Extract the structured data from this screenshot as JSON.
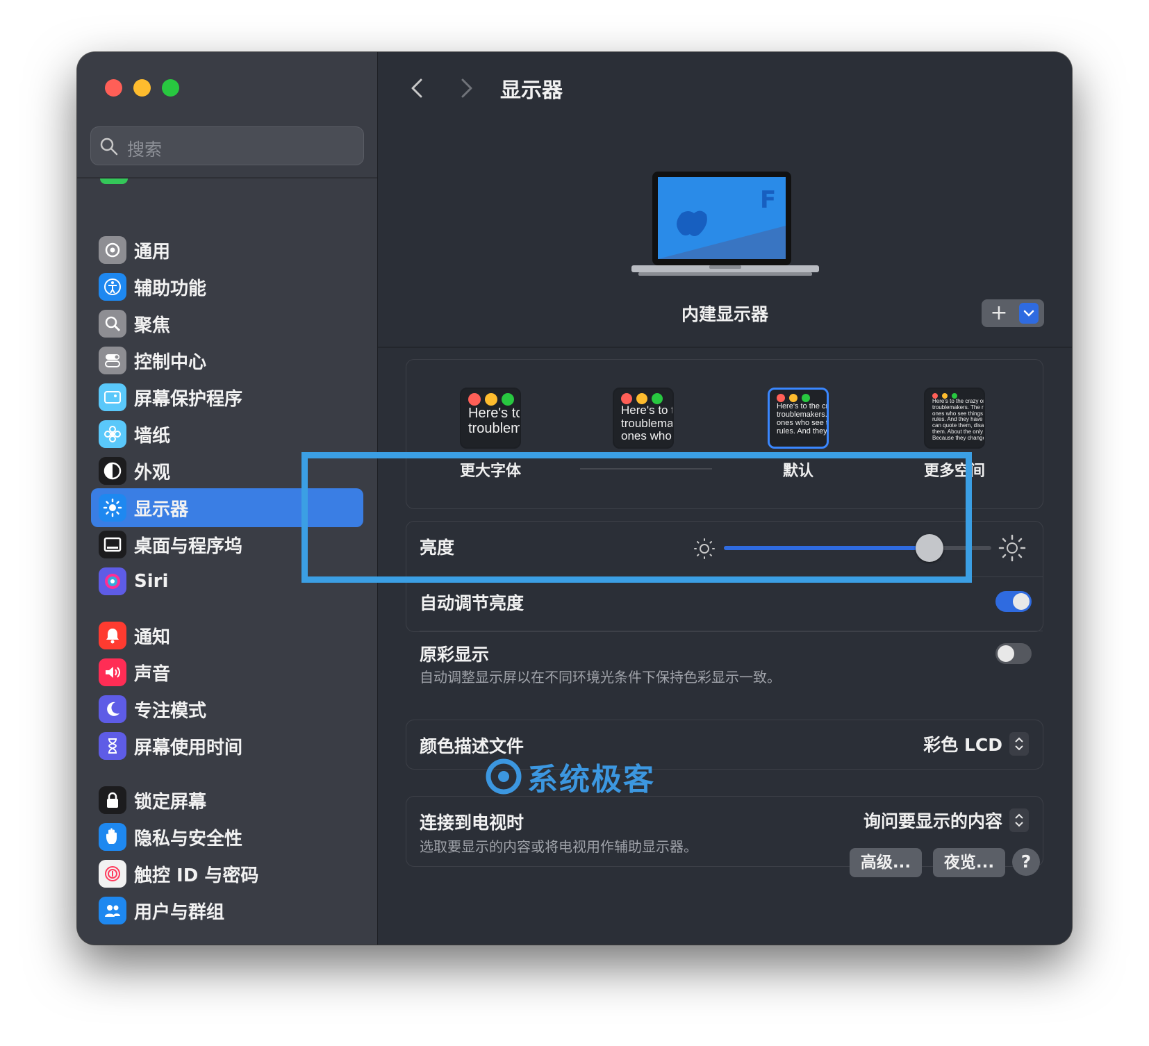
{
  "sidebar": {
    "search_placeholder": "搜索",
    "items": [
      {
        "label": "通用",
        "icon": "gear-icon",
        "color": "#8e8e93"
      },
      {
        "label": "辅助功能",
        "icon": "accessibility-icon",
        "color": "#1e88f0"
      },
      {
        "label": "聚焦",
        "icon": "magnifier-icon",
        "color": "#8e8e93"
      },
      {
        "label": "控制中心",
        "icon": "toggles-icon",
        "color": "#8e8e93"
      },
      {
        "label": "屏幕保护程序",
        "icon": "screensaver-icon",
        "color": "#5ac8fa"
      },
      {
        "label": "墙纸",
        "icon": "flower-icon",
        "color": "#5ac8fa"
      },
      {
        "label": "外观",
        "icon": "appearance-icon",
        "color": "#1c1c1e"
      },
      {
        "label": "显示器",
        "icon": "sun-icon",
        "color": "#1e88f0",
        "active": true
      },
      {
        "label": "桌面与程序坞",
        "icon": "dock-icon",
        "color": "#1c1c1e"
      },
      {
        "label": "Siri",
        "icon": "siri-icon",
        "color": "#5e5ce6"
      },
      {
        "label": "通知",
        "icon": "bell-icon",
        "color": "#ff3b30"
      },
      {
        "label": "声音",
        "icon": "speaker-icon",
        "color": "#ff2d55"
      },
      {
        "label": "专注模式",
        "icon": "moon-icon",
        "color": "#5e5ce6"
      },
      {
        "label": "屏幕使用时间",
        "icon": "hourglass-icon",
        "color": "#5e5ce6"
      },
      {
        "label": "锁定屏幕",
        "icon": "lock-icon",
        "color": "#1c1c1e"
      },
      {
        "label": "隐私与安全性",
        "icon": "hand-icon",
        "color": "#1e88f0"
      },
      {
        "label": "触控 ID 与密码",
        "icon": "fingerprint-icon",
        "color": "#f2f2f2"
      },
      {
        "label": "用户与群组",
        "icon": "users-icon",
        "color": "#1e88f0"
      }
    ]
  },
  "header": {
    "title": "显示器"
  },
  "display": {
    "name": "内建显示器",
    "add_label": "+"
  },
  "resolution": {
    "options": [
      {
        "label": "更大字体",
        "preview": "Here's tc\ntroublem"
      },
      {
        "label": "",
        "preview": "Here's to t\ntroublema\nones who"
      },
      {
        "label": "默认",
        "preview": "Here's to the cr\ntroublemakers.\nones who see t\nrules. And they",
        "selected": true
      },
      {
        "label": "更多空间",
        "preview": "Here's to the crazy one\ntroublemakers. The rou\nones who see things di\nrules. And they have no\ncan quote them, disagr\nthem. About the only th\nBecause they change th"
      }
    ]
  },
  "brightness": {
    "label": "亮度",
    "value": 0.77
  },
  "auto_brightness": {
    "label": "自动调节亮度",
    "on": true
  },
  "true_tone": {
    "label": "原彩显示",
    "description": "自动调整显示屏以在不同环境光条件下保持色彩显示一致。",
    "on": false
  },
  "color_profile": {
    "label": "颜色描述文件",
    "value": "彩色 LCD"
  },
  "tv": {
    "label": "连接到电视时",
    "description": "选取要显示的内容或将电视用作辅助显示器。",
    "value": "询问要显示的内容"
  },
  "buttons": {
    "advanced": "高级...",
    "night_shift": "夜览...",
    "help": "?"
  },
  "watermark": "系统极客",
  "colors": {
    "accent": "#2f6be0",
    "highlight": "#3b9fe4"
  }
}
